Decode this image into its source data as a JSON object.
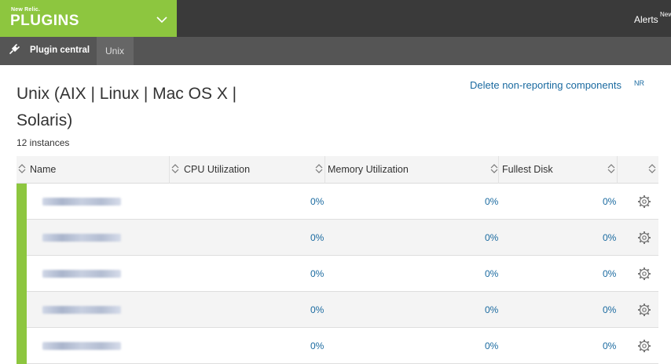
{
  "header": {
    "brand_small": "New Relic.",
    "brand_big": "PLUGINS",
    "alerts_label": "Alerts",
    "alerts_sup": "New"
  },
  "subnav": {
    "items": [
      {
        "label": "Plugin central"
      },
      {
        "label": "Unix"
      }
    ]
  },
  "page": {
    "title": "Unix (AIX | Linux | Mac OS X | Solaris)",
    "instances": "12 instances",
    "delete_link": "Delete non-reporting components",
    "delete_sup": "NR"
  },
  "table": {
    "columns": [
      "Name",
      "CPU Utilization",
      "Memory Utilization",
      "Fullest Disk"
    ],
    "rows": [
      {
        "cpu": "0%",
        "memory": "0%",
        "disk": "0%"
      },
      {
        "cpu": "0%",
        "memory": "0%",
        "disk": "0%"
      },
      {
        "cpu": "0%",
        "memory": "0%",
        "disk": "0%"
      },
      {
        "cpu": "0%",
        "memory": "0%",
        "disk": "0%"
      },
      {
        "cpu": "0%",
        "memory": "0%",
        "disk": "0%"
      }
    ]
  },
  "colors": {
    "brand_green": "#8dc63f",
    "topbar": "#3a3a3a",
    "subnav": "#555555",
    "link_blue": "#1a6aa0",
    "health_ok": "#8dc63f"
  },
  "icons": [
    "chevron-down-icon",
    "plug-icon",
    "sort-icon",
    "gear-icon"
  ]
}
